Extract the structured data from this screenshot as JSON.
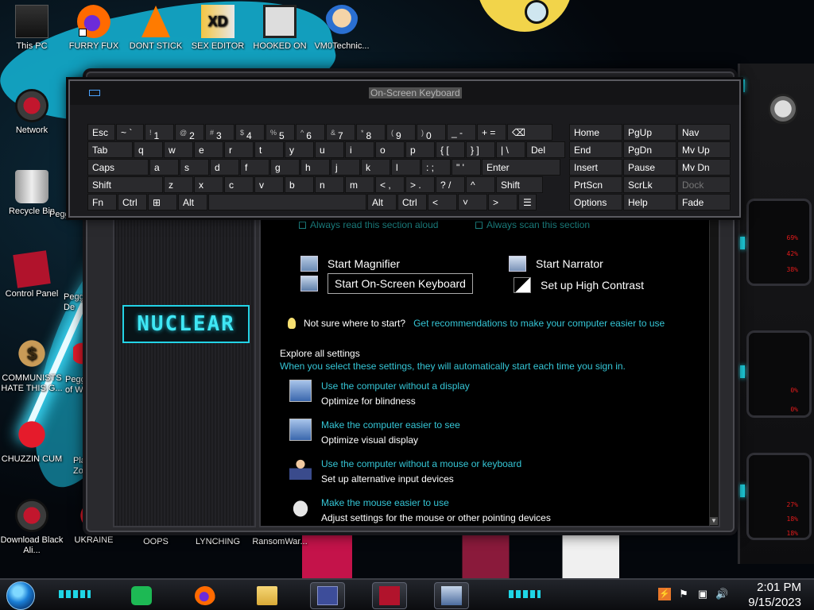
{
  "desktop": {
    "icons": [
      {
        "label": "This PC",
        "kind": "pc",
        "icon": "computer-icon"
      },
      {
        "label": "FURRY FUX",
        "kind": "fox",
        "icon": "firefox-icon"
      },
      {
        "label": "DONT STICK",
        "kind": "cone",
        "icon": "vlc-cone-icon"
      },
      {
        "label": "SEX EDITOR",
        "kind": "hxd",
        "icon": "hex-editor-icon"
      },
      {
        "label": "HOOKED ON",
        "kind": "maze",
        "icon": "maze-icon"
      },
      {
        "label": "VM0Technic...",
        "kind": "doc",
        "icon": "doctor-icon"
      },
      {
        "label": "Network",
        "kind": "alien",
        "icon": "network-icon"
      },
      {
        "label": "Recycle Bin",
        "kind": "bin",
        "icon": "recycle-bin-icon"
      },
      {
        "label": "Peggl",
        "kind": "red",
        "icon": "peggle-icon"
      },
      {
        "label": "Control Panel",
        "kind": "cpanel",
        "icon": "control-panel-icon"
      },
      {
        "label": "Peggle De",
        "kind": "red",
        "icon": "peggle-deluxe-icon"
      },
      {
        "label": "COMMUNISTS HATE THIS G...",
        "kind": "dollar",
        "icon": "money-bag-icon"
      },
      {
        "label": "Peggle of Wa",
        "kind": "red",
        "icon": "peggle-nights-icon"
      },
      {
        "label": "CHUZZIN CUM",
        "kind": "red",
        "icon": "chuzzle-icon"
      },
      {
        "label": "Plan Zo",
        "kind": "red",
        "icon": "plants-zombies-icon"
      },
      {
        "label": "Download Black Ali...",
        "kind": "alien",
        "icon": "alien-theme-icon"
      },
      {
        "label": "UKRAINE",
        "kind": "red",
        "icon": "shortcut-icon"
      },
      {
        "label": "OOPS",
        "kind": "none",
        "icon": "shortcut-icon"
      },
      {
        "label": "LYNCHING",
        "kind": "none",
        "icon": "shortcut-icon"
      },
      {
        "label": "RansomWar...",
        "kind": "none",
        "icon": "shortcut-icon"
      }
    ]
  },
  "osk": {
    "title": "On-Screen Keyboard",
    "rows": [
      [
        {
          "label": "Esc"
        },
        {
          "label": "~ `"
        },
        {
          "sup": "!",
          "label": "1"
        },
        {
          "sup": "@",
          "label": "2"
        },
        {
          "sup": "#",
          "label": "3"
        },
        {
          "sup": "$",
          "label": "4"
        },
        {
          "sup": "%",
          "label": "5"
        },
        {
          "sup": "^",
          "label": "6"
        },
        {
          "sup": "&",
          "label": "7"
        },
        {
          "sup": "*",
          "label": "8"
        },
        {
          "sup": "(",
          "label": "9"
        },
        {
          "sup": ")",
          "label": "0"
        },
        {
          "label": "_ -"
        },
        {
          "label": "+ ="
        },
        {
          "label": "⌫"
        }
      ],
      [
        {
          "label": "Tab"
        },
        {
          "label": "q"
        },
        {
          "label": "w"
        },
        {
          "label": "e"
        },
        {
          "label": "r"
        },
        {
          "label": "t"
        },
        {
          "label": "y"
        },
        {
          "label": "u"
        },
        {
          "label": "i"
        },
        {
          "label": "o"
        },
        {
          "label": "p"
        },
        {
          "label": "{ ["
        },
        {
          "label": "} ]"
        },
        {
          "label": "| \\"
        },
        {
          "label": "Del"
        }
      ],
      [
        {
          "label": "Caps"
        },
        {
          "label": "a"
        },
        {
          "label": "s"
        },
        {
          "label": "d"
        },
        {
          "label": "f"
        },
        {
          "label": "g"
        },
        {
          "label": "h"
        },
        {
          "label": "j"
        },
        {
          "label": "k"
        },
        {
          "label": "l"
        },
        {
          "label": ": ;"
        },
        {
          "label": "\" '"
        },
        {
          "label": "Enter"
        }
      ],
      [
        {
          "label": "Shift"
        },
        {
          "label": "z"
        },
        {
          "label": "x"
        },
        {
          "label": "c"
        },
        {
          "label": "v"
        },
        {
          "label": "b"
        },
        {
          "label": "n"
        },
        {
          "label": "m"
        },
        {
          "label": "< ,"
        },
        {
          "label": "> ."
        },
        {
          "label": "? /"
        },
        {
          "label": "^"
        },
        {
          "label": "Shift"
        }
      ],
      [
        {
          "label": "Fn"
        },
        {
          "label": "Ctrl"
        },
        {
          "label": "⊞"
        },
        {
          "label": "Alt"
        },
        {
          "label": ""
        },
        {
          "label": "Alt"
        },
        {
          "label": "Ctrl"
        },
        {
          "label": "<"
        },
        {
          "label": "˅"
        },
        {
          "label": ">"
        },
        {
          "label": "☰"
        }
      ]
    ],
    "nav_rows": [
      [
        "Home",
        "PgUp",
        "Nav"
      ],
      [
        "End",
        "PgDn",
        "Mv Up"
      ],
      [
        "Insert",
        "Pause",
        "Mv Dn"
      ],
      [
        "PrtScn",
        "ScrLk",
        "Dock"
      ],
      [
        "Options",
        "Help",
        "Fade"
      ]
    ]
  },
  "accessibility": {
    "logo": "NUCLEAR",
    "checkbox_read": "Always read this section aloud",
    "checkbox_scan": "Always scan this section",
    "tools": {
      "magnifier": "Start Magnifier",
      "narrator": "Start Narrator",
      "osk": "Start On-Screen Keyboard",
      "contrast": "Set up High Contrast"
    },
    "hint_text": "Not sure where to start?",
    "hint_link": "Get recommendations to make your computer easier to use",
    "explore_heading": "Explore all settings",
    "explore_sub": "When you select these settings, they will automatically start each time you sign in.",
    "settings": [
      {
        "title": "Use the computer without a display",
        "desc": "Optimize for blindness",
        "icon": "monitor-icon"
      },
      {
        "title": "Make the computer easier to see",
        "desc": "Optimize visual display",
        "icon": "monitor-icon"
      },
      {
        "title": "Use the computer without a mouse or keyboard",
        "desc": "Set up alternative input devices",
        "icon": "person-icon"
      },
      {
        "title": "Make the mouse easier to use",
        "desc": "Adjust settings for the mouse or other pointing devices",
        "icon": "mouse-icon"
      }
    ]
  },
  "gadget": {
    "stats": [
      "69%",
      "42%",
      "38%",
      "0%",
      "0%",
      "27%",
      "18%",
      "18%"
    ]
  },
  "taskbar": {
    "time": "2:01 PM",
    "date": "9/15/2023"
  },
  "colors": {
    "link": "#35c6d6",
    "accent_cyan": "#1fd6e6",
    "accent_red": "#e21b1b"
  }
}
